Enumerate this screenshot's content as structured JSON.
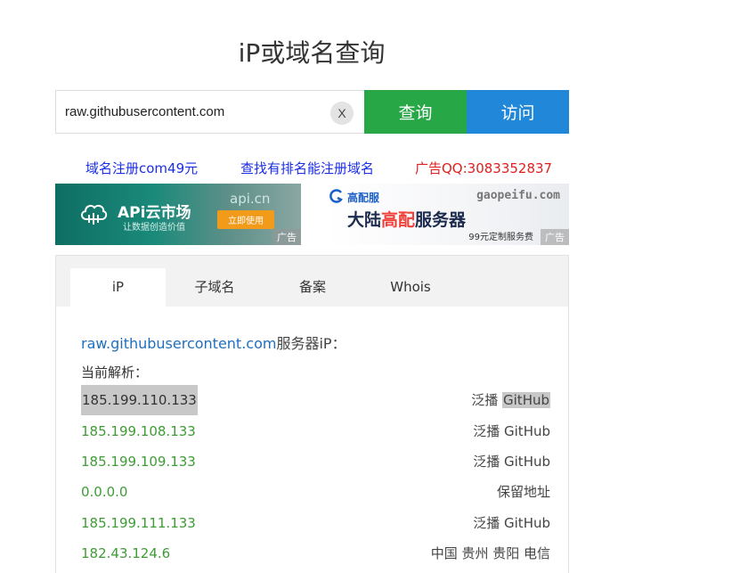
{
  "page": {
    "title": "iP或域名查询"
  },
  "search": {
    "value": "raw.githubusercontent.com",
    "clear_label": "X",
    "query_label": "查询",
    "visit_label": "访问"
  },
  "links": [
    {
      "text": "域名注册com49元"
    },
    {
      "text": "查找有排名能注册域名"
    },
    {
      "text": "广告QQ:3083352837"
    }
  ],
  "ads": {
    "left": {
      "brand": "APi云市场",
      "slogan": "让数据创造价值",
      "domain": "api.cn",
      "cta": "立即使用",
      "tag": "广告"
    },
    "right": {
      "brand": "高配服",
      "domain": "gaopeifu.com",
      "headline_a": "大陆",
      "headline_b": "高配",
      "headline_c": "服务器",
      "price": "99元定制服务费",
      "tag": "广告"
    }
  },
  "tabs": [
    {
      "label": "iP",
      "active": true
    },
    {
      "label": "子域名"
    },
    {
      "label": "备案"
    },
    {
      "label": "Whois"
    }
  ],
  "result": {
    "domain": "raw.githubusercontent.com",
    "heading_suffix": "服务器iP：",
    "current_label": "当前解析：",
    "rows": [
      {
        "ip": "185.199.110.133",
        "loc_a": "泛播",
        "loc_b": "GitHub"
      },
      {
        "ip": "185.199.108.133",
        "loc": "泛播 GitHub"
      },
      {
        "ip": "185.199.109.133",
        "loc": "泛播 GitHub"
      },
      {
        "ip": "0.0.0.0",
        "loc": "保留地址"
      },
      {
        "ip": "185.199.111.133",
        "loc": "泛播 GitHub"
      },
      {
        "ip": "182.43.124.6",
        "loc": "中国 贵州 贵阳 电信"
      }
    ]
  },
  "colors": {
    "query_button": "#27a746",
    "visit_button": "#2187d9",
    "link_blue": "#1a2ee6",
    "link_red": "#e02020",
    "ip_green": "#3f9c35",
    "heading_blue": "#1f6fbf"
  },
  "icons": {
    "clear": "close-icon",
    "ad_left": "cloud-icon",
    "ad_right": "gaopeifu-logo-icon"
  }
}
